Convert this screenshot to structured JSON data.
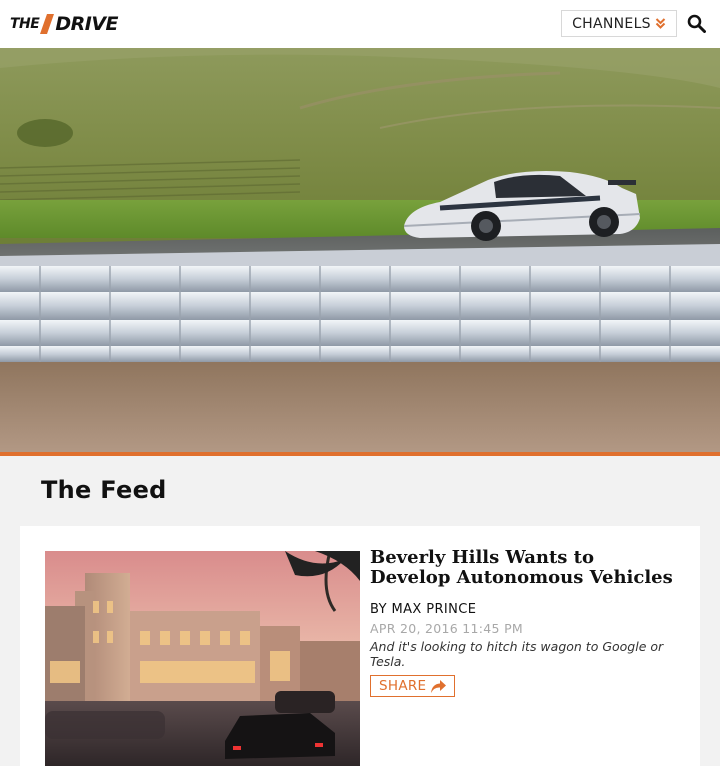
{
  "header": {
    "logo_prefix": "THE",
    "logo_word": "DRIVE",
    "channels_label": "CHANNELS",
    "icons": {
      "channels": "chevron-double-down-icon",
      "search": "search-icon"
    }
  },
  "colors": {
    "accent": "#e0702e",
    "background": "#f2f2f2",
    "text": "#111111",
    "muted": "#a8a8a8"
  },
  "hero": {
    "image": "sports car on racetrack beside tire barrier"
  },
  "feed": {
    "title": "The Feed",
    "articles": [
      {
        "headline": "Beverly Hills Wants to Develop Autonomous Vehicles",
        "byline": "BY MAX PRINCE",
        "date": "APR 20, 2016 11:45 PM",
        "dek": "And it's looking to hitch its wagon to Google or Tesla.",
        "share_label": "SHARE",
        "share_icon": "share-arrow-icon",
        "image": "Beverly Hills street at dusk"
      }
    ]
  }
}
